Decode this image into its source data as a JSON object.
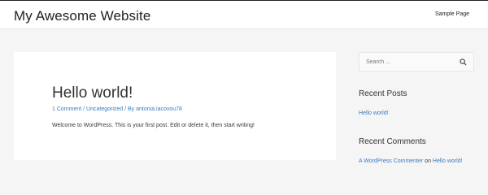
{
  "header": {
    "site_title": "My Awesome Website",
    "nav_link": "Sample Page"
  },
  "post": {
    "title": "Hello world!",
    "meta_comments": "1 Comment",
    "meta_sep1": " / ",
    "meta_category": "Uncategorized",
    "meta_sep2": " / By ",
    "meta_author": "antonia.iacovou78",
    "content": "Welcome to WordPress. This is your first post. Edit or delete it, then start writing!"
  },
  "sidebar": {
    "search": {
      "placeholder": "Search ...",
      "icon": "search-icon"
    },
    "recent_posts": {
      "title": "Recent Posts",
      "items": [
        "Hello world!"
      ]
    },
    "recent_comments": {
      "title": "Recent Comments",
      "commenter": "A WordPress Commenter",
      "on_text": " on ",
      "post_link": "Hello world!"
    }
  },
  "colors": {
    "link": "#3a7bbf",
    "background": "#f5f5f5",
    "card": "#ffffff"
  }
}
